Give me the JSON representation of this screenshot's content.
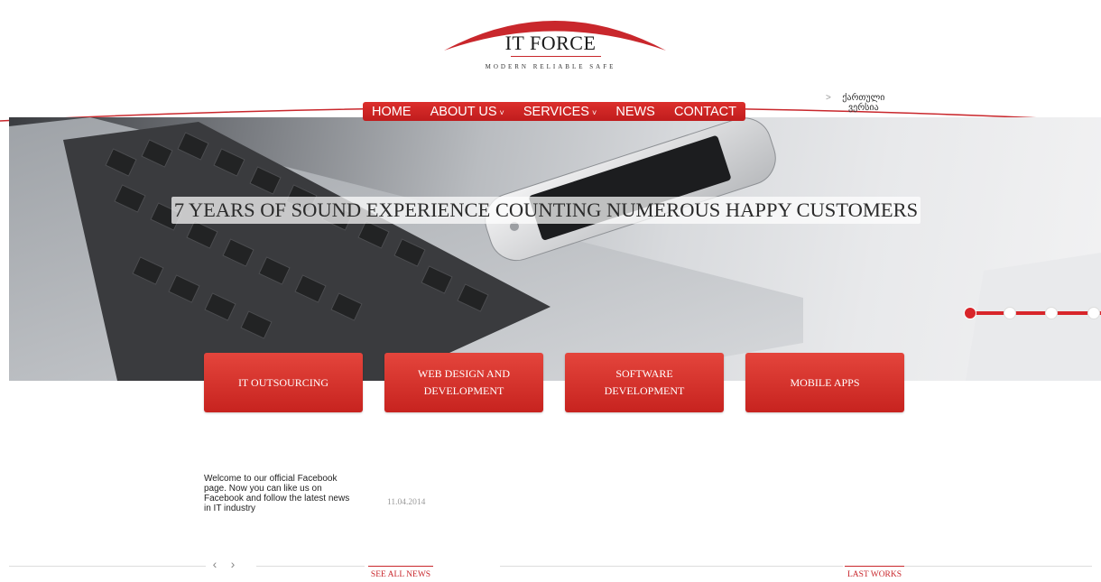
{
  "logo": {
    "title": "IT FORCE",
    "tagline": "MODERN RELIABLE SAFE"
  },
  "nav": {
    "items": [
      {
        "label": "HOME"
      },
      {
        "label": "ABOUT US",
        "caret": "˅"
      },
      {
        "label": "SERVICES",
        "caret": "˅"
      },
      {
        "label": "NEWS"
      },
      {
        "label": "CONTACT"
      }
    ]
  },
  "language": {
    "chevron": ">",
    "label": "ქართული ვერსია"
  },
  "hero": {
    "headline": "7 YEARS OF SOUND EXPERIENCE COUNTING NUMEROUS HAPPY CUSTOMERS",
    "slider": {
      "count": 4,
      "active": 0
    }
  },
  "services": [
    {
      "label": "IT OUTSOURCING"
    },
    {
      "label": "WEB DESIGN AND DEVELOPMENT"
    },
    {
      "label": "SOFTWARE DEVELOPMENT"
    },
    {
      "label": "MOBILE APPS"
    }
  ],
  "news": {
    "text": "Welcome to our official Facebook page. Now you can like us on Facebook and follow the latest news in IT industry",
    "date": "11.04.2014",
    "prev": "‹",
    "next": "›"
  },
  "footer_tabs": {
    "see_all_news": "SEE ALL NEWS",
    "last_works": "LAST WORKS"
  },
  "colors": {
    "brand_red": "#d8252a",
    "text_dark": "#222222"
  }
}
